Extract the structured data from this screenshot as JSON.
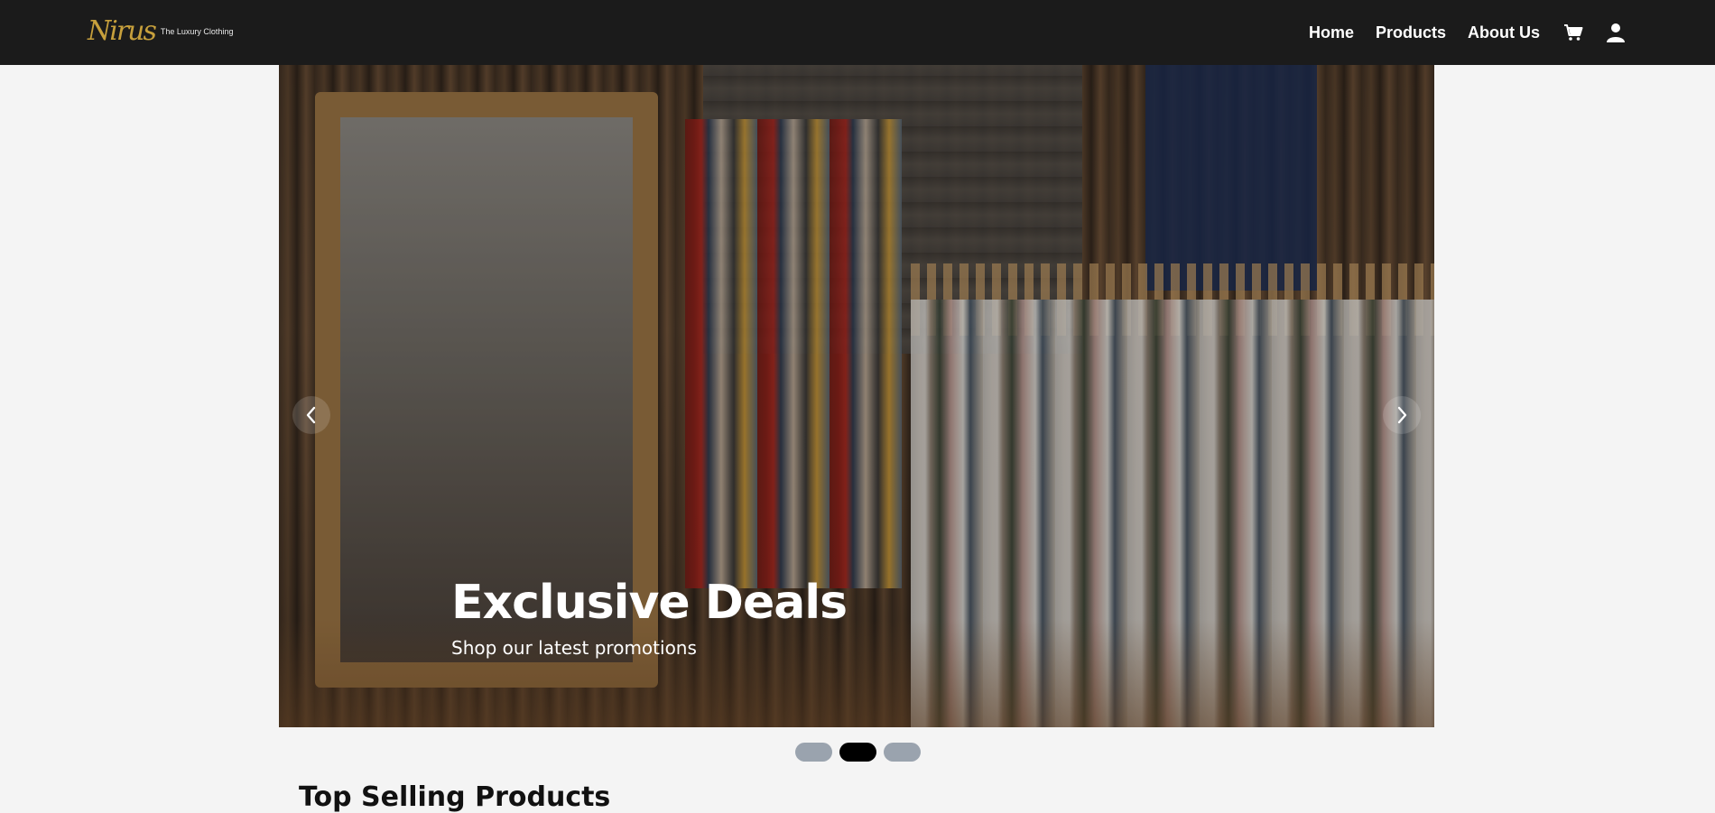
{
  "header": {
    "brand_mark": "Nirus",
    "brand_tagline": "The Luxury Clothing",
    "nav": {
      "home": "Home",
      "products": "Products",
      "about": "About Us"
    },
    "icons": [
      "cart-icon",
      "user-icon"
    ]
  },
  "hero": {
    "title": "Exclusive Deals",
    "subtitle": "Shop our latest promotions",
    "prev_icon": "chevron-left-icon",
    "next_icon": "chevron-right-icon"
  },
  "carousel": {
    "slides": 3,
    "active_index": 1
  },
  "sections": {
    "top_selling_title": "Top Selling Products"
  },
  "colors": {
    "header_bg": "#1b1b1b",
    "brand_gold": "#c7a03c",
    "page_bg": "#f4f4f4",
    "dot_inactive": "#9aa3ae",
    "dot_active": "#000000"
  }
}
